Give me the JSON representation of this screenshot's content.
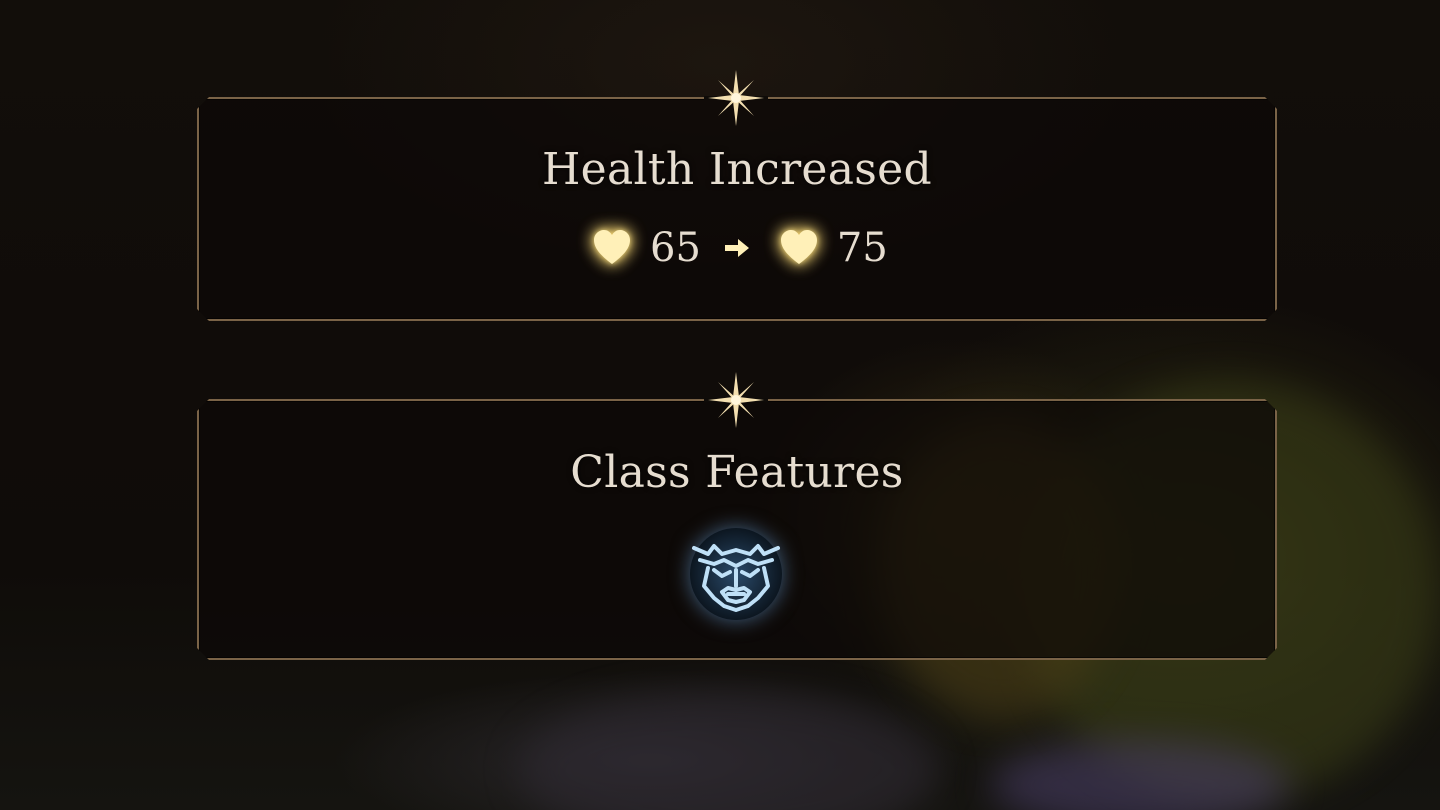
{
  "level_up": {
    "health": {
      "title": "Health Increased",
      "old_value": "65",
      "new_value": "75",
      "icon": "heart-icon",
      "arrow_icon": "arrow-right-icon"
    },
    "class_features": {
      "title": "Class Features",
      "feature_icon": "barbarian-rage-mask-icon"
    },
    "divider_icon": "sparkle-star-icon"
  },
  "colors": {
    "panel_border": "#7a6347",
    "text": "#e6ddd0",
    "heart_glow": "#ffd45a",
    "feature_icon": "#9cc8ec"
  }
}
